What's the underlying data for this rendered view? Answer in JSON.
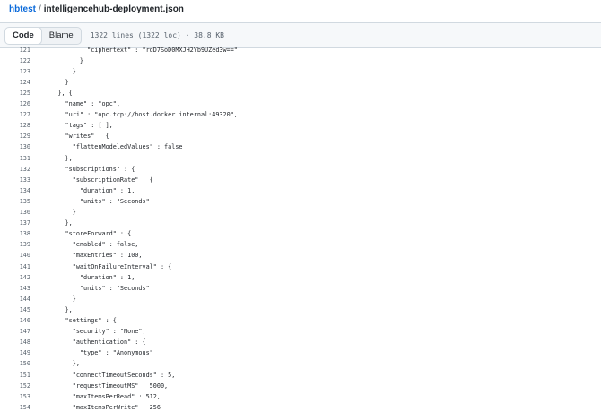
{
  "breadcrumb": {
    "repo": "hbtest",
    "separator": "/",
    "file": "intelligencehub-deployment.json"
  },
  "toolbar": {
    "code_label": "Code",
    "blame_label": "Blame",
    "file_meta": "1322 lines (1322 loc) · 38.8 KB"
  },
  "code_lines": [
    {
      "n": "121",
      "t": "            \"ciphertext\" : \"rdD7SoD0MXJH2Yb9UZed3w==\""
    },
    {
      "n": "122",
      "t": "          }"
    },
    {
      "n": "123",
      "t": "        }"
    },
    {
      "n": "124",
      "t": "      }"
    },
    {
      "n": "125",
      "t": "    }, {"
    },
    {
      "n": "126",
      "t": "      \"name\" : \"opc\","
    },
    {
      "n": "127",
      "t": "      \"uri\" : \"opc.tcp://host.docker.internal:49320\","
    },
    {
      "n": "128",
      "t": "      \"tags\" : [ ],"
    },
    {
      "n": "129",
      "t": "      \"writes\" : {"
    },
    {
      "n": "130",
      "t": "        \"flattenModeledValues\" : false"
    },
    {
      "n": "131",
      "t": "      },"
    },
    {
      "n": "132",
      "t": "      \"subscriptions\" : {"
    },
    {
      "n": "133",
      "t": "        \"subscriptionRate\" : {"
    },
    {
      "n": "134",
      "t": "          \"duration\" : 1,"
    },
    {
      "n": "135",
      "t": "          \"units\" : \"Seconds\""
    },
    {
      "n": "136",
      "t": "        }"
    },
    {
      "n": "137",
      "t": "      },"
    },
    {
      "n": "138",
      "t": "      \"storeForward\" : {"
    },
    {
      "n": "139",
      "t": "        \"enabled\" : false,"
    },
    {
      "n": "140",
      "t": "        \"maxEntries\" : 100,"
    },
    {
      "n": "141",
      "t": "        \"waitOnFailureInterval\" : {"
    },
    {
      "n": "142",
      "t": "          \"duration\" : 1,"
    },
    {
      "n": "143",
      "t": "          \"units\" : \"Seconds\""
    },
    {
      "n": "144",
      "t": "        }"
    },
    {
      "n": "145",
      "t": "      },"
    },
    {
      "n": "146",
      "t": "      \"settings\" : {"
    },
    {
      "n": "147",
      "t": "        \"security\" : \"None\","
    },
    {
      "n": "148",
      "t": "        \"authentication\" : {"
    },
    {
      "n": "149",
      "t": "          \"type\" : \"Anonymous\""
    },
    {
      "n": "150",
      "t": "        },"
    },
    {
      "n": "151",
      "t": "        \"connectTimeoutSeconds\" : 5,"
    },
    {
      "n": "152",
      "t": "        \"requestTimeoutMS\" : 5000,"
    },
    {
      "n": "153",
      "t": "        \"maxItemsPerRead\" : 512,"
    },
    {
      "n": "154",
      "t": "        \"maxItemsPerWrite\" : 256"
    }
  ]
}
